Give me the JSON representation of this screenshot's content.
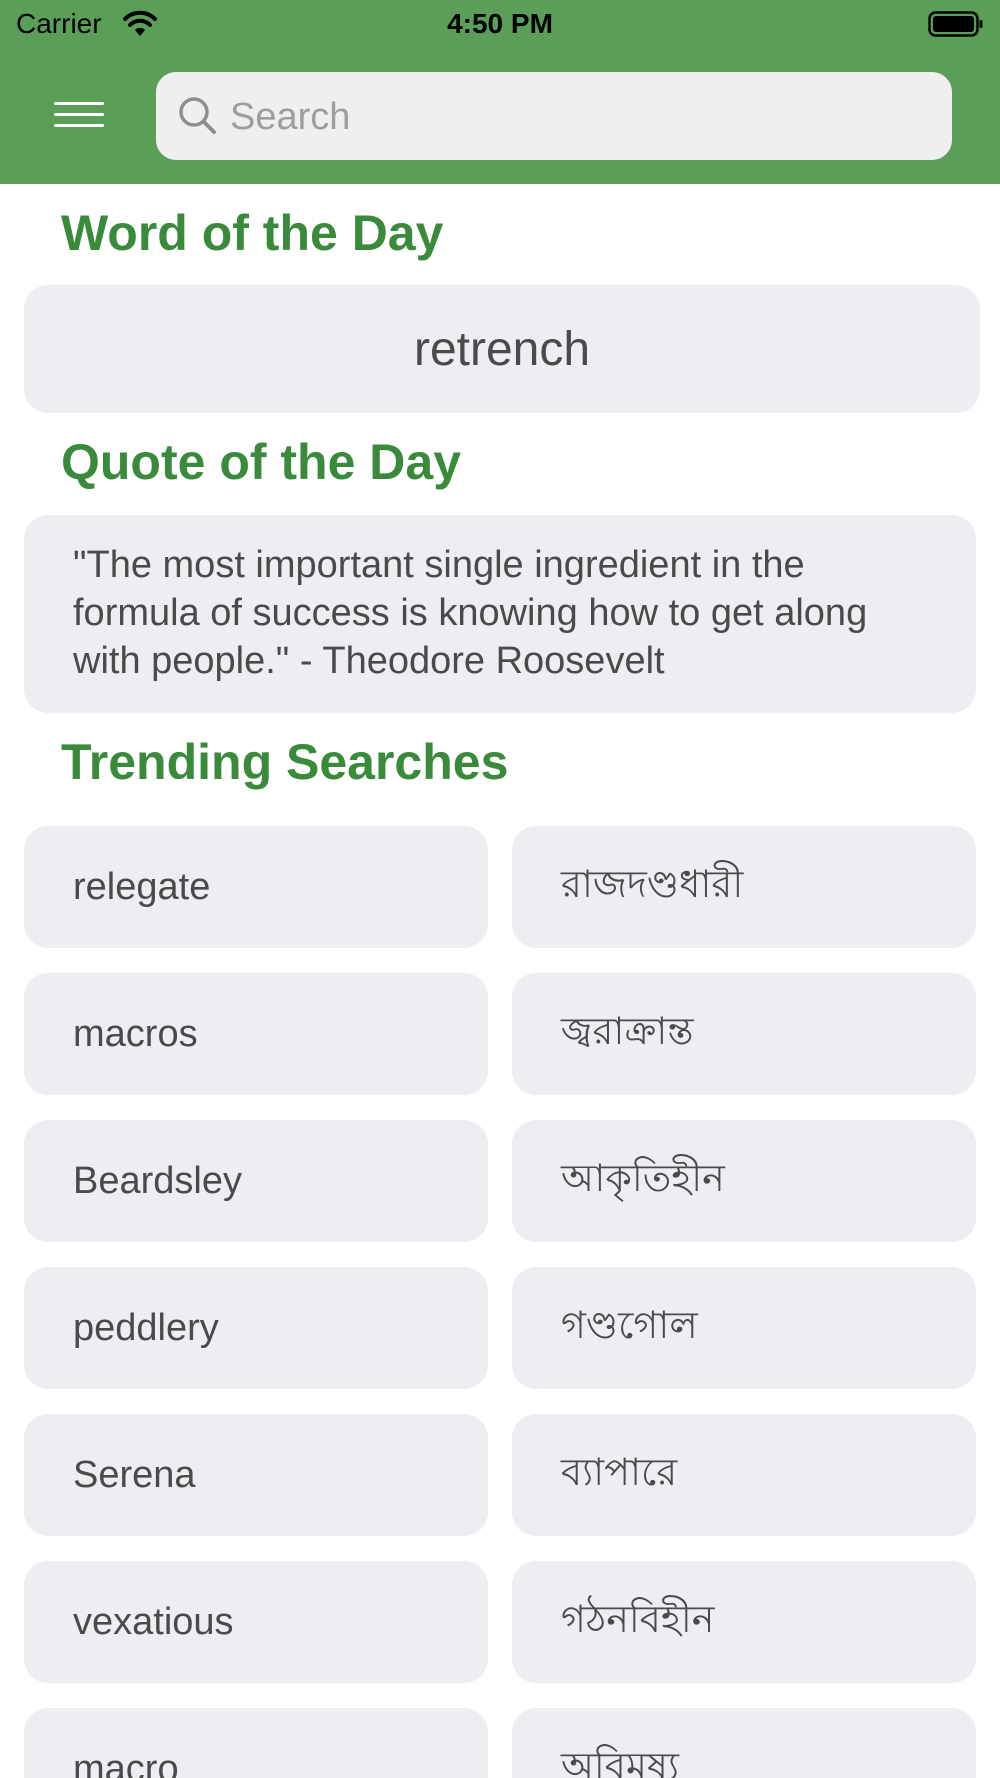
{
  "status_bar": {
    "carrier": "Carrier",
    "time": "4:50 PM"
  },
  "header": {
    "menu_icon": "hamburger-menu-icon",
    "search_icon": "search-icon",
    "search_placeholder": "Search",
    "search_value": "",
    "background_color": "#5a9e58"
  },
  "word_of_the_day": {
    "title": "Word of the Day",
    "word": "retrench"
  },
  "quote_of_the_day": {
    "title": "Quote of the Day",
    "quote": "\"The most important single ingredient in the formula of success is knowing how to get along with people.\" - Theodore Roosevelt"
  },
  "trending": {
    "title": "Trending Searches",
    "items": [
      "relegate",
      "রাজদণ্ডধারী",
      "macros",
      "জ্বরাক্রান্ত",
      "Beardsley",
      "আকৃতিহীন",
      "peddlery",
      "গণ্ডগোল",
      "Serena",
      "ব্যাপারে",
      "vexatious",
      "গঠনবিহীন",
      "macro",
      "অবিমৃষ্য"
    ]
  },
  "colors": {
    "accent": "#3a8a3c",
    "card_background": "#eeeef2",
    "text": "#4a4a4a"
  }
}
